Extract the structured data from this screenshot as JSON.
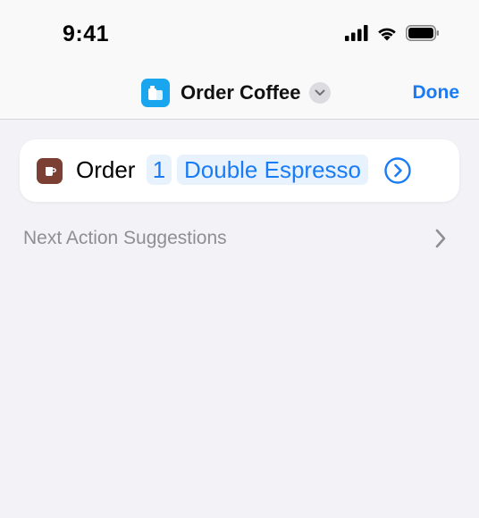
{
  "status_bar": {
    "time": "9:41",
    "icons": [
      "cellular-signal-icon",
      "wifi-icon",
      "battery-icon"
    ]
  },
  "nav": {
    "app_icon": "shortcut-icon",
    "title": "Order Coffee",
    "title_menu_icon": "chevron-down-icon",
    "done_label": "Done"
  },
  "action": {
    "icon": "coffee-cup-icon",
    "verb": "Order",
    "quantity": "1",
    "item": "Double Espresso",
    "detail_icon": "chevron-right-circle-icon"
  },
  "suggestions": {
    "label": "Next Action Suggestions",
    "icon": "chevron-right-icon"
  },
  "colors": {
    "background": "#f2f2f7",
    "accent": "#1a7cf5",
    "app_icon": "#1aa6ef",
    "action_icon": "#7b3f33",
    "token_background": "#e8f2fd",
    "secondary_text": "#8e8e93"
  }
}
